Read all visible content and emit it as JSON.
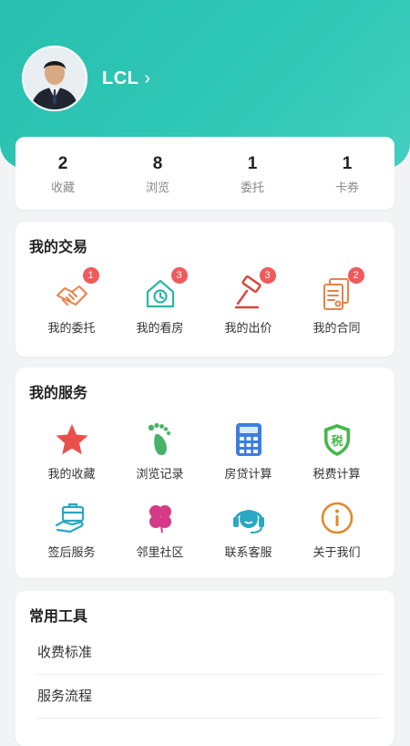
{
  "profile": {
    "name": "LCL",
    "chevron": "›"
  },
  "stats": [
    {
      "value": "2",
      "label": "收藏"
    },
    {
      "value": "8",
      "label": "浏览"
    },
    {
      "value": "1",
      "label": "委托"
    },
    {
      "value": "1",
      "label": "卡券"
    }
  ],
  "trade": {
    "title": "我的交易",
    "items": [
      {
        "label": "我的委托",
        "badge": "1",
        "icon": "handshake-icon"
      },
      {
        "label": "我的看房",
        "badge": "3",
        "icon": "house-clock-icon"
      },
      {
        "label": "我的出价",
        "badge": "3",
        "icon": "gavel-icon"
      },
      {
        "label": "我的合同",
        "badge": "2",
        "icon": "contract-icon"
      }
    ]
  },
  "services": {
    "title": "我的服务",
    "items": [
      {
        "label": "我的收藏",
        "icon": "star-icon"
      },
      {
        "label": "浏览记录",
        "icon": "footprint-icon"
      },
      {
        "label": "房贷计算",
        "icon": "calculator-icon"
      },
      {
        "label": "税费计算",
        "icon": "tax-shield-icon",
        "icon_text": "税"
      },
      {
        "label": "签后服务",
        "icon": "briefcase-hand-icon"
      },
      {
        "label": "邻里社区",
        "icon": "clover-icon"
      },
      {
        "label": "联系客服",
        "icon": "headset-icon"
      },
      {
        "label": "关于我们",
        "icon": "info-icon"
      }
    ]
  },
  "tools": {
    "title": "常用工具",
    "items": [
      {
        "label": "收费标准"
      },
      {
        "label": "服务流程"
      }
    ]
  },
  "colors": {
    "header": "#2fc7b5",
    "badge": "#ef5b5b",
    "trade_icon_orange": "#e8824a",
    "trade_icon_teal": "#2bb6a3",
    "trade_icon_red": "#d8453b",
    "star": "#e9504b",
    "footprint": "#46b26a",
    "calculator": "#3a7fe0",
    "tax": "#46b84a",
    "headset": "#2aa7c2",
    "clover": "#d63a86",
    "info": "#e08a2a"
  }
}
